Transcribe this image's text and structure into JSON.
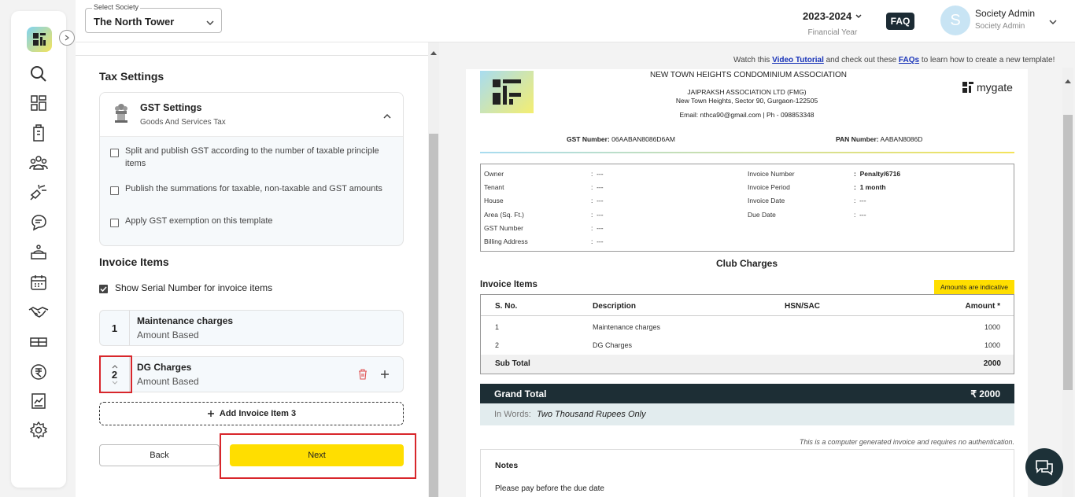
{
  "header": {
    "society_label": "Select Society",
    "society_value": "The North Tower",
    "financial_year": "2023-2024",
    "financial_year_label": "Financial Year",
    "faq": "FAQ",
    "avatar_initial": "S",
    "admin_name": "Society Admin",
    "admin_role": "Society Admin"
  },
  "sidebar": {
    "items": [
      "search-icon",
      "dashboard-icon",
      "building-icon",
      "residents-icon",
      "helpdesk-icon",
      "chat-icon",
      "service-icon",
      "calendar-icon",
      "handshake-icon",
      "gift-icon",
      "rupee-icon",
      "reports-icon",
      "settings-icon"
    ]
  },
  "form": {
    "tax_settings_title": "Tax Settings",
    "gst_title": "GST Settings",
    "gst_subtitle": "Goods And Services Tax",
    "gst_options": [
      {
        "label": "Split and publish GST according to the number of taxable principle items",
        "checked": false
      },
      {
        "label": "Publish the summations for taxable, non-taxable and GST amounts",
        "checked": false
      },
      {
        "label": "Apply GST exemption on this template",
        "checked": false
      }
    ],
    "invoice_items_title": "Invoice Items",
    "show_serial_label": "Show Serial Number for invoice items",
    "items": [
      {
        "num": "1",
        "name": "Maintenance charges",
        "type": "Amount Based"
      },
      {
        "num": "2",
        "name": "DG Charges",
        "type": "Amount Based"
      }
    ],
    "add_item_label": "Add Invoice Item 3",
    "back_label": "Back",
    "next_label": "Next"
  },
  "preview": {
    "tutorial_pre": "Watch this",
    "tutorial_link": "Video Tutorial",
    "tutorial_mid": "and check out these",
    "faq_link": "FAQs",
    "tutorial_post": "to learn how to create a new template!",
    "org_name": "NEW TOWN HEIGHTS CONDOMINIUM ASSOCIATION",
    "org_sub": "JAIPRAKSH ASSOCIATION LTD (FMG)",
    "org_address": "New Town Heights, Sector 90, Gurgaon-122505",
    "org_contact": "Email: nthca90@gmail.com | Ph - 098853348",
    "brand": "mygate",
    "gst_label": "GST Number:",
    "gst_value": "06AABAN8086D6AM",
    "pan_label": "PAN Number:",
    "pan_value": "AABAN8086D",
    "details_left": [
      {
        "label": "Owner",
        "value": "---"
      },
      {
        "label": "Tenant",
        "value": "---"
      },
      {
        "label": "House",
        "value": "---"
      },
      {
        "label": "Area (Sq. Ft.)",
        "value": "---"
      },
      {
        "label": "GST Number",
        "value": "---"
      },
      {
        "label": "Billing Address",
        "value": "---"
      }
    ],
    "details_right": [
      {
        "label": "Invoice Number",
        "value": "Penalty/6716"
      },
      {
        "label": "Invoice Period",
        "value": "1 month"
      },
      {
        "label": "Invoice Date",
        "value": "---"
      },
      {
        "label": "Due Date",
        "value": "---"
      }
    ],
    "charge_title": "Club Charges",
    "invoice_items_title": "Invoice Items",
    "indicative": "Amounts are indicative",
    "table_headers": [
      "S. No.",
      "Description",
      "HSN/SAC",
      "Amount *"
    ],
    "rows": [
      {
        "sno": "1",
        "desc": "Maintenance charges",
        "hsn": "",
        "amount": "1000"
      },
      {
        "sno": "2",
        "desc": "DG Charges",
        "hsn": "",
        "amount": "1000"
      }
    ],
    "subtotal_label": "Sub Total",
    "subtotal_value": "2000",
    "grand_label": "Grand Total",
    "grand_value": "₹ 2000",
    "words_label": "In Words:",
    "words_value": "Two Thousand Rupees Only",
    "computer_note": "This is a computer generated invoice and requires no authentication.",
    "notes_title": "Notes",
    "notes_text": "Please pay before the due date"
  }
}
